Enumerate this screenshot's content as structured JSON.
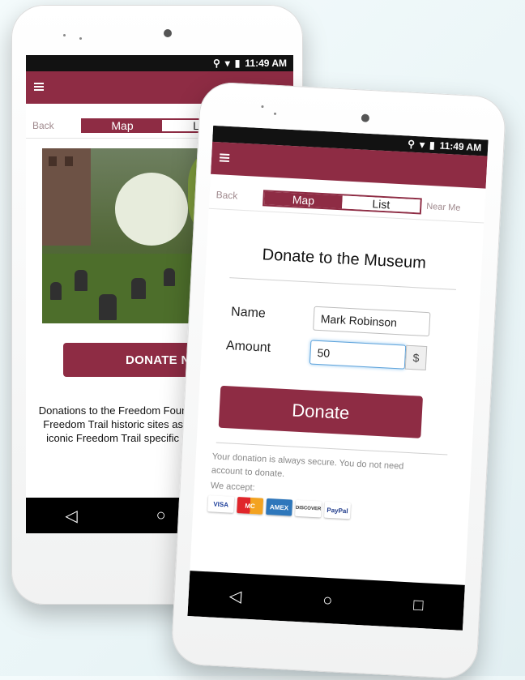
{
  "status": {
    "time": "11:49 AM"
  },
  "nav": {
    "back": "Back",
    "tab_map": "Map",
    "tab_list": "List",
    "near_me": "Near Me"
  },
  "left_screen": {
    "donate_now": "DONATE NOW",
    "description": "Donations to the Freedom Foundation and official Freedom Trail historic sites assists the Boston's iconic Freedom Trail specific sites as well as p"
  },
  "right_screen": {
    "title": "Donate to the Museum",
    "name_label": "Name",
    "name_value": "Mark Robinson",
    "amount_label": "Amount",
    "amount_value": "50",
    "currency": "$",
    "donate_button": "Donate",
    "secure_text": "Your donation is always secure. You do not need account to donate.",
    "we_accept": "We accept:",
    "cards": [
      "VISA",
      "MC",
      "AMEX",
      "DISCOVER",
      "PayPal"
    ]
  },
  "system_nav": {
    "back": "◁",
    "home": "○",
    "recent": "□"
  },
  "colors": {
    "brand": "#8e2c44",
    "status_bar": "#121212"
  }
}
